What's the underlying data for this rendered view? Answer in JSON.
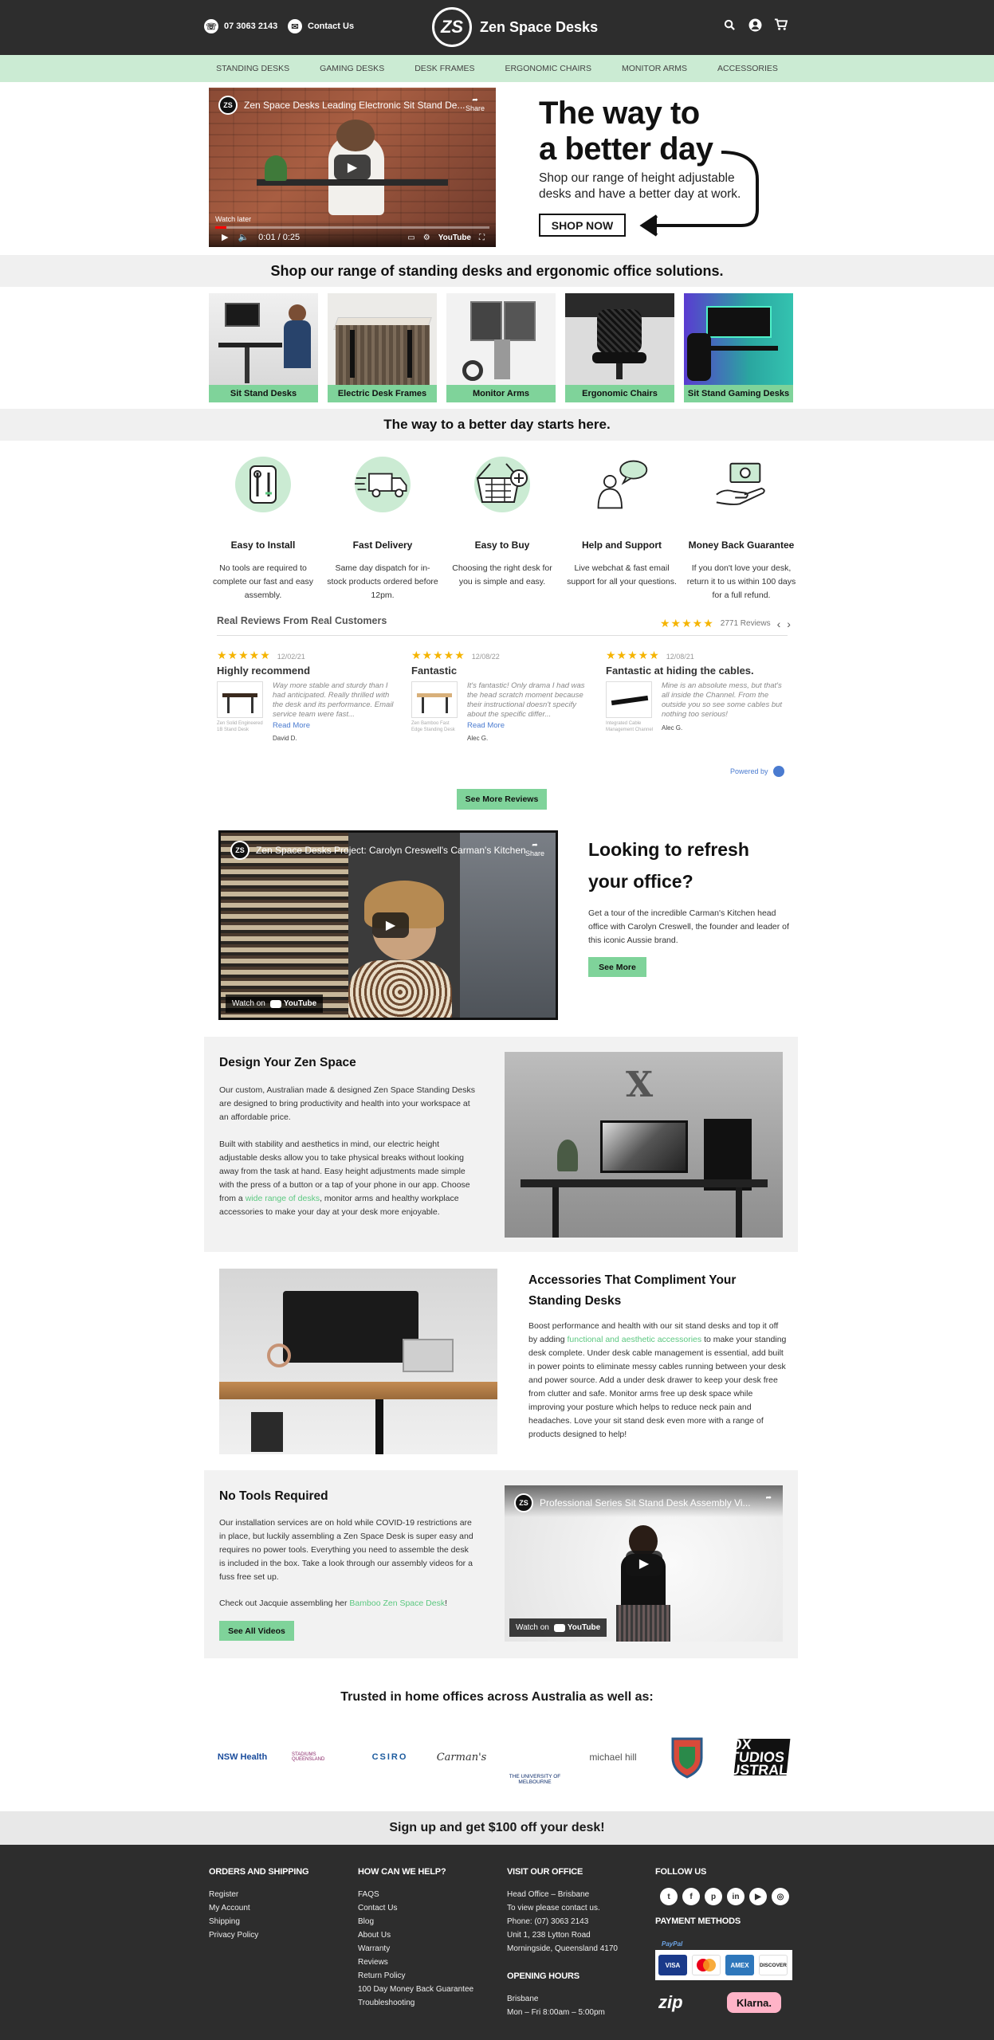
{
  "header": {
    "phone": "07 3063 2143",
    "contact": "Contact Us",
    "logo_mark": "ZS",
    "brand": "Zen Space Desks",
    "icons": [
      "search-icon",
      "user-icon",
      "cart-icon"
    ]
  },
  "nav": [
    "STANDING DESKS",
    "GAMING DESKS",
    "DESK FRAMES",
    "ERGONOMIC CHAIRS",
    "MONITOR ARMS",
    "ACCESSORIES"
  ],
  "hero": {
    "video_title": "Zen Space Desks Leading Electronic Sit Stand De...",
    "share": "Share",
    "watch_later": "Watch later",
    "video_time": "0:01 / 0:25",
    "title_line1": "The way to",
    "title_line2": "a better day",
    "subtitle": "Shop our range of height adjustable desks and have a better day at work.",
    "cta": "SHOP NOW"
  },
  "range_heading": "Shop our range of standing desks and ergonomic office solutions.",
  "categories": [
    {
      "label": "Sit Stand Desks"
    },
    {
      "label": "Electric Desk Frames"
    },
    {
      "label": "Monitor Arms"
    },
    {
      "label": "Ergonomic Chairs"
    },
    {
      "label": "Sit Stand Gaming Desks"
    }
  ],
  "better_day_heading": "The way to a better day starts here.",
  "features": [
    {
      "title": "Easy to Install",
      "desc": "No tools are required to complete our fast and easy assembly.",
      "icon": "tools-icon"
    },
    {
      "title": "Fast Delivery",
      "desc": "Same day dispatch for in-stock products ordered before 12pm.",
      "icon": "truck-icon"
    },
    {
      "title": "Easy to Buy",
      "desc": "Choosing the right desk for you is simple and easy.",
      "icon": "basket-icon"
    },
    {
      "title": "Help and Support",
      "desc": "Live webchat & fast email support for all your questions.",
      "icon": "support-icon"
    },
    {
      "title": "Money Back Guarantee",
      "desc": "If you don't love your desk, return it to us within 100 days for a full refund.",
      "icon": "money-icon"
    }
  ],
  "reviews": {
    "heading": "Real Reviews From Real Customers",
    "count": "2771 Reviews",
    "powered_by": "Powered by",
    "items": [
      {
        "date": "12/02/21",
        "title": "Highly recommend",
        "text": "Way more stable and sturdy than I had anticipated. Really thrilled with the desk and its performance. Email service team were fast...",
        "more": "Read More",
        "product": "Zen Solid Engineered 1B Stand Desk",
        "name": "David D."
      },
      {
        "date": "12/08/22",
        "title": "Fantastic",
        "text": "It's fantastic! Only drama I had was the head scratch moment because their instructional doesn't specify about the specific differ...",
        "more": "Read More",
        "product": "Zen Bamboo Fast Edge Standing Desk",
        "name": "Alec G."
      },
      {
        "date": "12/08/21",
        "title": "Fantastic at hiding the cables.",
        "text": "Mine is an absolute mess, but that's all inside the Channel. From the outside you so see some cables but nothing too serious!",
        "more": "",
        "product": "Integrated Cable Management Channel",
        "name": "Alec G."
      }
    ],
    "see_more": "See More Reviews"
  },
  "refresh": {
    "video_title": "Zen Space Desks Project: Carolyn Creswell's Carman's Kitchen",
    "share": "Share",
    "watch_on": "Watch on",
    "youtube": "YouTube",
    "title": "Looking to refresh your office?",
    "text": "Get a tour of the incredible Carman's Kitchen head office with Carolyn Creswell, the founder and leader of this iconic Aussie brand.",
    "button": "See More"
  },
  "design": {
    "title": "Design Your Zen Space",
    "p1": "Our custom, Australian made & designed Zen Space Standing Desks are designed to bring productivity and health into your workspace at an affordable price.",
    "p2_before": "Built with stability and aesthetics in mind, our electric height adjustable desks allow you to take physical breaks without looking away from the task at hand. Easy height adjustments made simple with the press of a button or a tap of your phone in our app. Choose from a ",
    "p2_link": "wide range of desks",
    "p2_after": ", monitor arms and healthy workplace accessories to make your day at your desk more enjoyable."
  },
  "accessories": {
    "title": "Accessories That Compliment Your Standing Desks",
    "p_before": "Boost performance and health with our sit stand desks and top it off by adding ",
    "p_link": "functional and aesthetic accessories",
    "p_after": " to make your standing desk complete. Under desk cable management is essential, add built in power points to eliminate messy cables running between your desk and power source. Add a under desk drawer to keep your desk free from clutter and safe. Monitor arms free up desk space while improving your posture which helps to reduce neck pain and headaches. Love your sit stand desk even more with a range of products designed to help!"
  },
  "tools": {
    "title": "No Tools Required",
    "p1": "Our installation services are on hold while COVID-19 restrictions are in place, but luckily assembling a Zen Space Desk is super easy and requires no power tools. Everything you need to assemble the desk is included in the box. Take a look through our assembly videos for a fuss free set up.",
    "p2_before": "Check out Jacquie assembling her ",
    "p2_link": "Bamboo Zen Space Desk",
    "p2_after": "!",
    "button": "See All Videos",
    "video_title": "Professional Series Sit Stand Desk Assembly Vi...",
    "watch_on": "Watch on",
    "youtube": "YouTube"
  },
  "trusted": {
    "heading": "Trusted in home offices across Australia as well as:",
    "logos": [
      "NSW Health",
      "STADIUMS QUEENSLAND",
      "CSIRO",
      "Carman's",
      "THE UNIVERSITY OF MELBOURNE",
      "michael hill",
      "shield",
      "FOX STUDIOS AUSTRALIA"
    ]
  },
  "signup": "Sign up and get $100 off your desk!",
  "footer": {
    "orders": {
      "heading": "ORDERS AND SHIPPING",
      "links": [
        "Register",
        "My Account",
        "Shipping",
        "Privacy Policy"
      ]
    },
    "help": {
      "heading": "HOW CAN WE HELP?",
      "links": [
        "FAQS",
        "Contact Us",
        "Blog",
        "About Us",
        "Warranty",
        "Reviews",
        "Return Policy",
        "100 Day Money Back Guarantee",
        "Troubleshooting"
      ]
    },
    "office": {
      "heading": "VISIT OUR OFFICE",
      "lines": [
        "Head Office – Brisbane",
        "To view please contact us.",
        "Phone: (07) 3063 2143",
        "Unit 1, 238 Lytton Road",
        "Morningside, Queensland 4170"
      ]
    },
    "hours": {
      "heading": "OPENING HOURS",
      "lines": [
        "Brisbane",
        "Mon – Fri 8:00am – 5:00pm"
      ]
    },
    "follow": {
      "heading": "FOLLOW US",
      "icons": [
        "twitter-icon",
        "facebook-icon",
        "pinterest-icon",
        "linkedin-icon",
        "youtube-icon",
        "instagram-icon"
      ]
    },
    "payment": {
      "heading": "PAYMENT METHODS",
      "paypal": "PayPal",
      "cards": [
        "VISA",
        "MC",
        "AMEX",
        "DISCOVER"
      ],
      "zip": "zip",
      "klarna": "Klarna."
    }
  },
  "colors": {
    "dark": "#2d2d2d",
    "green": "#7fd39a",
    "nav_bg": "#cbebd3",
    "link_green": "#5cc880",
    "star": "#f5b400"
  }
}
